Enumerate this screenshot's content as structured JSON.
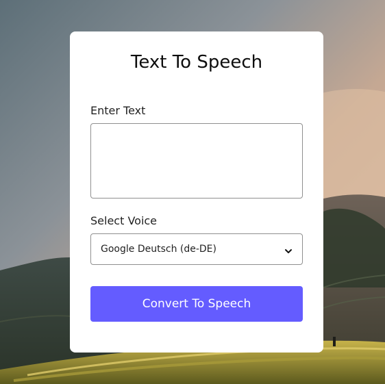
{
  "card": {
    "title": "Text To Speech",
    "text_label": "Enter Text",
    "text_value": "",
    "voice_label": "Select Voice",
    "voice_selected": "Google Deutsch (de-DE)",
    "button_label": "Convert To Speech"
  },
  "colors": {
    "accent": "#645cff",
    "card_bg": "#ffffff",
    "text": "#111111",
    "border": "#8f8f8f"
  },
  "icons": {
    "dropdown": "chevron-down-icon"
  }
}
